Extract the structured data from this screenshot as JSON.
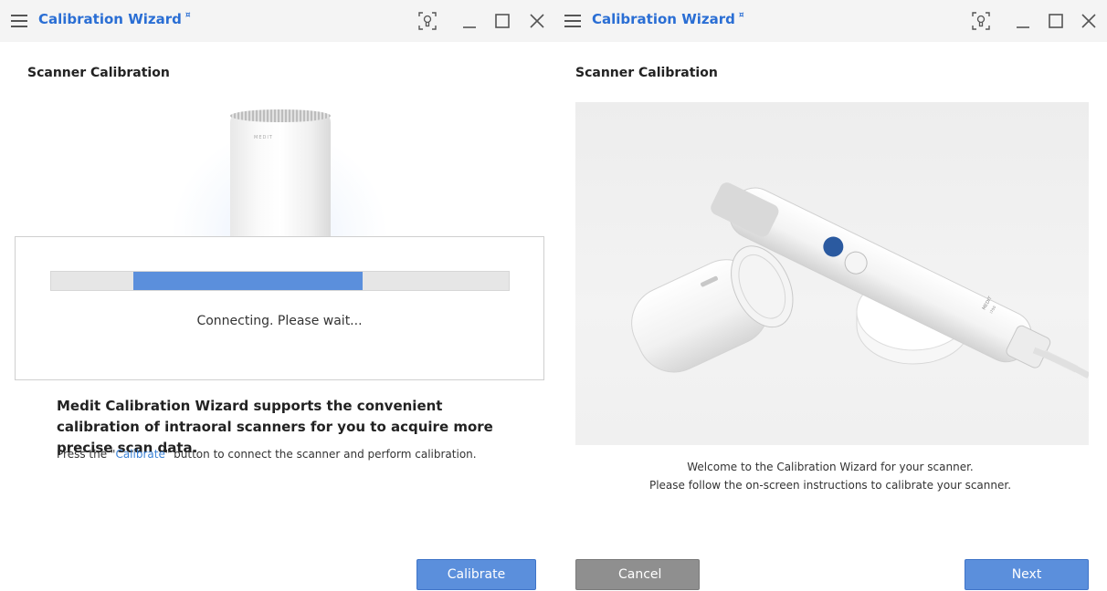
{
  "left_window": {
    "title": "Calibration Wizard",
    "title_badge": "¤",
    "heading": "Scanner Calibration",
    "progress": {
      "text": "Connecting. Please wait...",
      "fill_start": 0.18,
      "fill_end": 0.68
    },
    "info_bold": "Medit Calibration Wizard supports the convenient calibration of intraoral scanners for you to acquire more precise scan data.",
    "info_small_prefix": "Press the \"",
    "info_small_link": "Calibrate",
    "info_small_suffix": "\" button to connect the scanner and perform calibration.",
    "calibrate_button": "Calibrate",
    "device_label": "MEDIT"
  },
  "right_window": {
    "title": "Calibration Wizard",
    "title_badge": "¤",
    "heading": "Scanner Calibration",
    "welcome_line1": "Welcome to the Calibration Wizard for your scanner.",
    "welcome_line2": "Please follow the on-screen instructions to calibrate your scanner.",
    "cancel_button": "Cancel",
    "next_button": "Next",
    "scanner_brand": "MEDIT",
    "scanner_model": "i700"
  },
  "icons": [
    "menu-icon",
    "screen-capture-icon",
    "minimize-icon",
    "maximize-icon",
    "close-icon"
  ],
  "colors": {
    "accent": "#2a6ed4",
    "button_blue": "#5b8fdc",
    "button_gray": "#8f8f8f",
    "progress_fill": "#5b8fdc",
    "link": "#3b82d6"
  }
}
